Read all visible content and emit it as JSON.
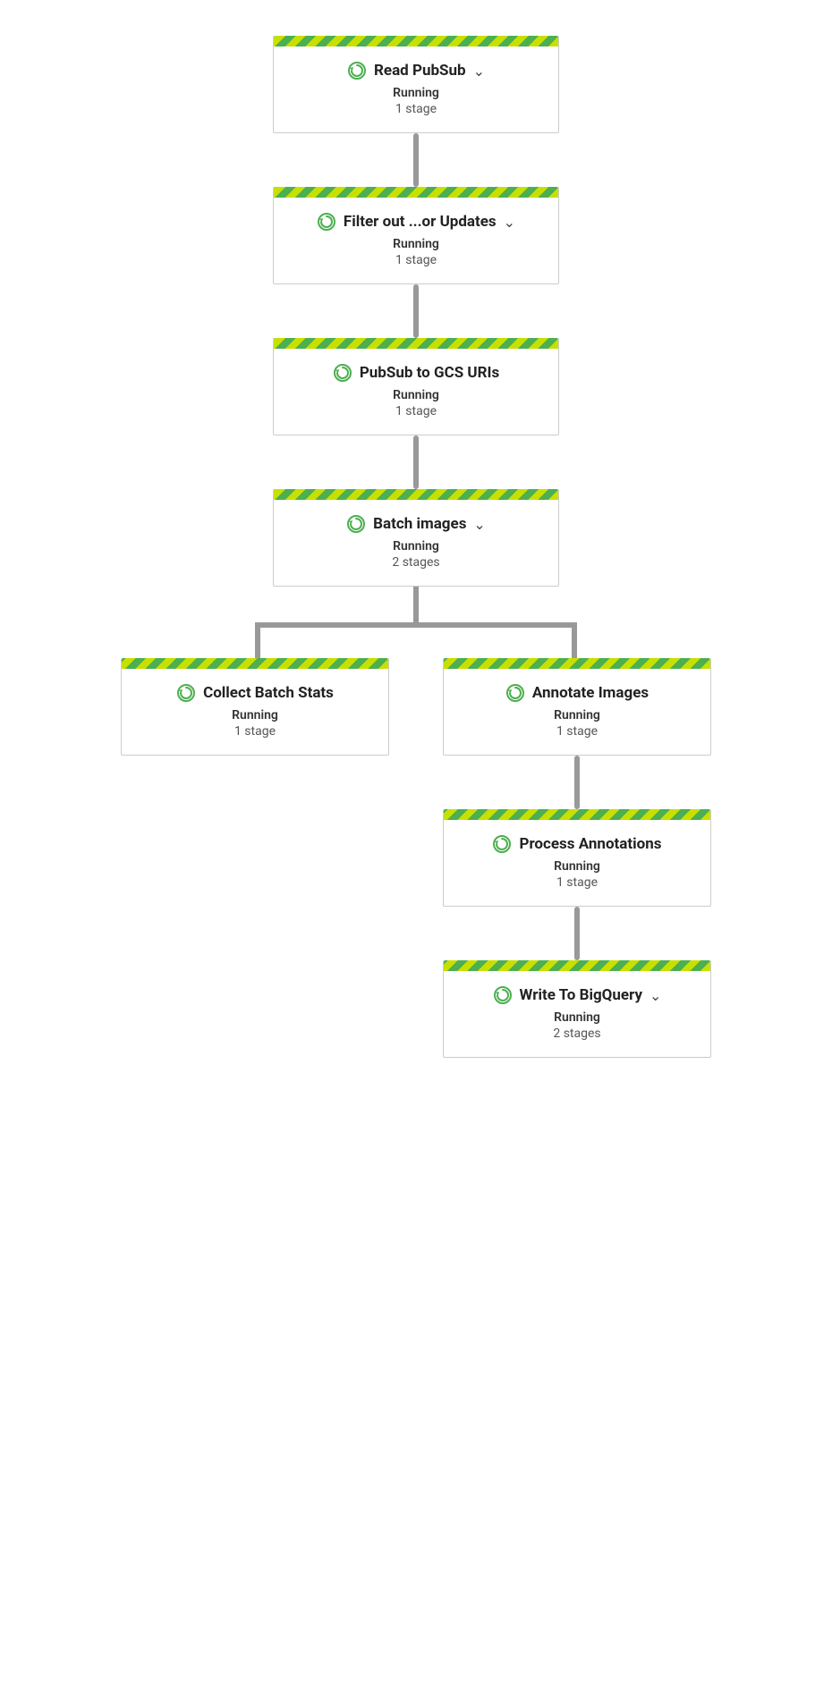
{
  "nodes": [
    {
      "id": "read-pubsub",
      "title": "Read PubSub",
      "status": "Running",
      "stages": "1 stage",
      "hasChevron": true,
      "wide": false
    },
    {
      "id": "filter-out",
      "title": "Filter out ...or Updates",
      "status": "Running",
      "stages": "1 stage",
      "hasChevron": true,
      "wide": false
    },
    {
      "id": "pubsub-gcs",
      "title": "PubSub to GCS URIs",
      "status": "Running",
      "stages": "1 stage",
      "hasChevron": false,
      "wide": false
    },
    {
      "id": "batch-images",
      "title": "Batch images",
      "status": "Running",
      "stages": "2 stages",
      "hasChevron": true,
      "wide": false
    }
  ],
  "fork_left": {
    "id": "collect-batch-stats",
    "title": "Collect Batch Stats",
    "status": "Running",
    "stages": "1 stage",
    "hasChevron": false
  },
  "fork_right": {
    "id": "annotate-images",
    "title": "Annotate Images",
    "status": "Running",
    "stages": "1 stage",
    "hasChevron": false
  },
  "nodes_after_fork": [
    {
      "id": "process-annotations",
      "title": "Process Annotations",
      "status": "Running",
      "stages": "1 stage",
      "hasChevron": false,
      "wide": false
    },
    {
      "id": "write-bigquery",
      "title": "Write To BigQuery",
      "status": "Running",
      "stages": "2 stages",
      "hasChevron": true,
      "wide": false
    }
  ],
  "icons": {
    "running": "↺",
    "chevron": "∨"
  },
  "colors": {
    "stripe1": "#c8e000",
    "stripe2": "#4caf50",
    "connector": "#999999",
    "border": "#cccccc",
    "title": "#222222",
    "status": "#333333",
    "stages": "#555555"
  }
}
